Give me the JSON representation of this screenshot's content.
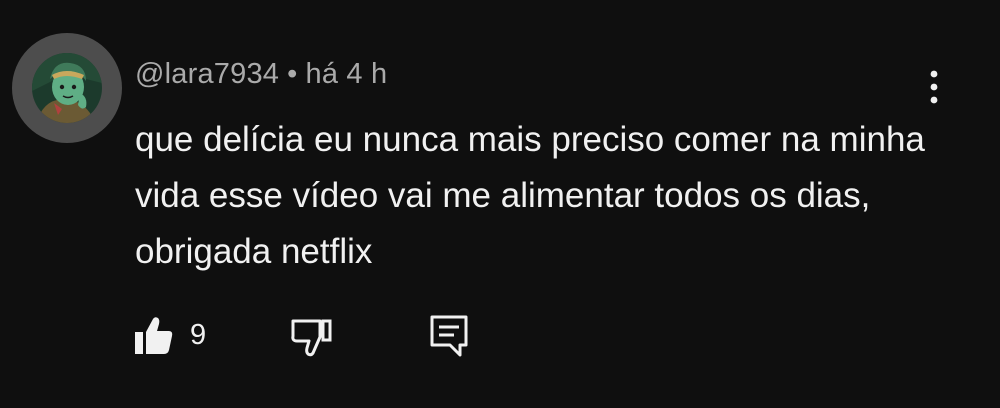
{
  "comment": {
    "author": "@lara7934",
    "separator": "•",
    "timestamp": "há 4 h",
    "text": "que delícia eu nunca mais preciso comer na minha vida esse vídeo vai me alimentar todos os dias, obrigada netflix",
    "like_count": "9"
  },
  "icons": {
    "avatar": "profile-avatar",
    "more": "three-dot-vertical-icon",
    "like": "thumbs-up-filled-icon",
    "dislike": "thumbs-down-outline-icon",
    "reply": "comment-bubble-icon"
  },
  "colors": {
    "background": "#0f0f0f",
    "text_primary": "#f1f1f1",
    "text_secondary": "#aaaaaa",
    "avatar_ring": "#4d4d4d"
  }
}
